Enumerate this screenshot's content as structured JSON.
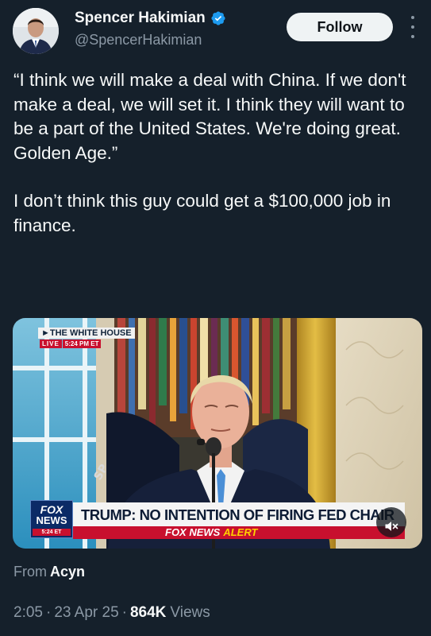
{
  "author": {
    "display_name": "Spencer Hakimian",
    "handle": "@SpencerHakimian",
    "verified": true,
    "follow_label": "Follow",
    "verified_icon": "verified-badge-icon",
    "more_icon": "more-vertical-icon"
  },
  "tweet": {
    "paragraphs": [
      "“I think we will make a deal with China. If we don't make a deal, we will set it. I think they will want to be a part of the United States. We're doing great. Golden Age.”",
      "I don’t think this guy could get a $100,000 job in finance."
    ]
  },
  "media": {
    "chyron_source": "►THE WHITE HOUSE",
    "live_label": "LIVE",
    "live_time": "5:24 PM ET",
    "network_bug_top": "FOX",
    "network_bug_bottom": "NEWS",
    "network_bug_time": "5:24 ET",
    "headline": "TRUMP: NO INTENTION OF FIRING FED CHAIR",
    "alert_brand": "FOX NEWS",
    "alert_word": "ALERT",
    "mute_icon": "speaker-muted-icon"
  },
  "source": {
    "prefix": "From",
    "name": "Acyn"
  },
  "meta": {
    "time": "2:05",
    "separator": "·",
    "date": "23 Apr 25",
    "views_count": "864K",
    "views_label": "Views"
  },
  "colors": {
    "background": "#15202b",
    "primary_text": "#f7f9f9",
    "secondary_text": "#8b98a5",
    "verified_blue": "#1d9bf0",
    "follow_button_bg": "#eff3f4",
    "fox_red": "#c8102e",
    "fox_navy": "#0b2a66"
  }
}
